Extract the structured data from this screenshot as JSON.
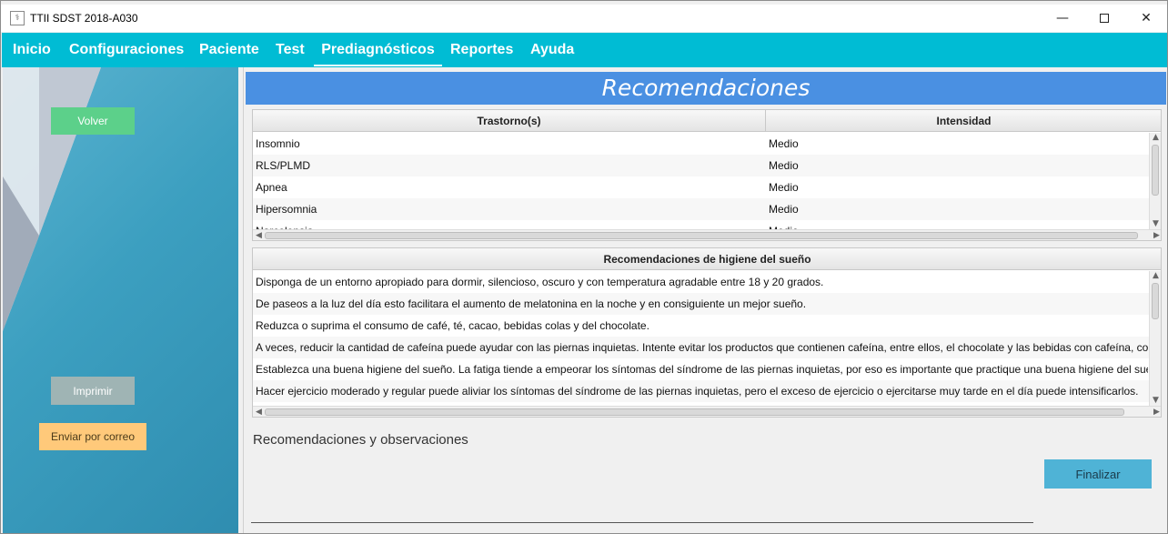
{
  "window": {
    "title": "TTII SDST 2018-A030",
    "icon": "app-logo-icon",
    "controls": [
      "minimize-icon",
      "maximize-icon",
      "close-icon"
    ]
  },
  "menu": {
    "items": [
      {
        "label": "Inicio"
      },
      {
        "label": "Configuraciones"
      },
      {
        "label": "Paciente"
      },
      {
        "label": "Test"
      },
      {
        "label": "Prediagnósticos",
        "active": true
      },
      {
        "label": "Reportes"
      },
      {
        "label": "Ayuda"
      }
    ]
  },
  "sidebar": {
    "back_label": "Volver",
    "print_label": "Imprimir",
    "email_label": "Enviar por correo"
  },
  "main": {
    "title": "Recomendaciones",
    "disorders": {
      "headers": [
        "Trastorno(s)",
        "Intensidad"
      ],
      "rows": [
        [
          "Insomnio",
          "Medio"
        ],
        [
          "RLS/PLMD",
          "Medio"
        ],
        [
          "Apnea",
          "Medio"
        ],
        [
          "Hipersomnia",
          "Medio"
        ],
        [
          "Narcolepsia",
          "Medio"
        ]
      ]
    },
    "hygiene": {
      "header": "Recomendaciones de higiene del sueño",
      "rows": [
        "Disponga de un entorno apropiado para dormir, silencioso, oscuro y con temperatura agradable entre 18 y 20 grados.",
        "De paseos a la luz del día esto facilitara el aumento de melatonina en la noche y en consiguiente un mejor sueño.",
        "Reduzca o suprima el consumo de café, té, cacao, bebidas colas y del chocolate.",
        "A veces, reducir la cantidad de cafeína puede ayudar con las piernas inquietas. Intente evitar los productos que contienen cafeína, entre ellos, el chocolate y las bebidas con cafeína, como",
        "Establezca una buena higiene del sueño. La fatiga tiende a empeorar los síntomas del síndrome de las piernas inquietas, por eso es importante que practique una buena higiene del sueñ",
        "Hacer ejercicio moderado y regular puede aliviar los síntomas del síndrome de las piernas inquietas, pero el exceso de ejercicio o ejercitarse muy tarde en el día puede intensificarlos."
      ]
    },
    "observations_label": "Recomendaciones y observaciones",
    "finish_label": "Finalizar"
  },
  "colors": {
    "menubar": "#00bcd4",
    "banner": "#4a90e2",
    "back_button": "#5cd08a",
    "print_button": "#9fb4b4",
    "email_button": "#ffc97a",
    "finish_button": "#4fb3d6"
  }
}
